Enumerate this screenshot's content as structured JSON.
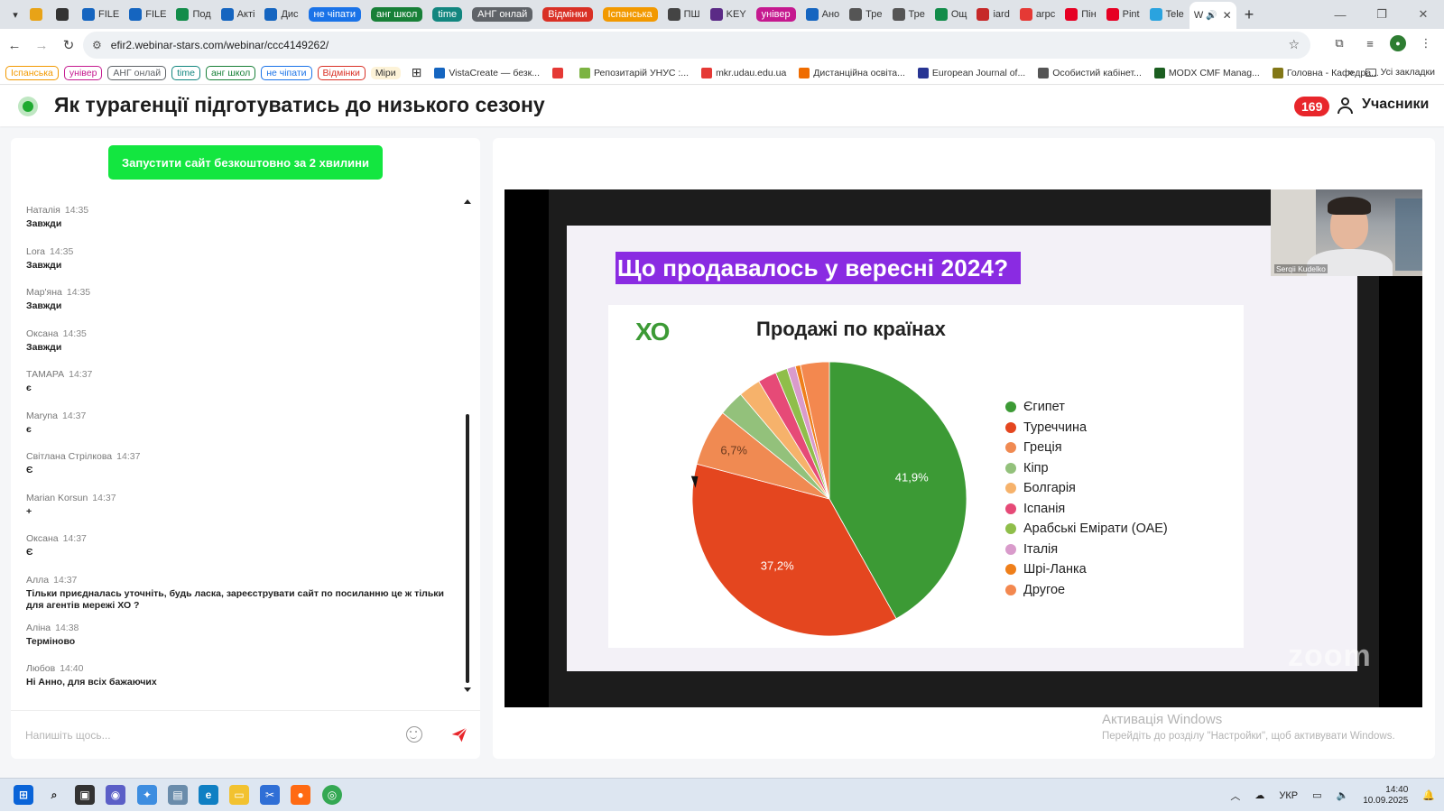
{
  "browser": {
    "tabs": [
      {
        "label": "",
        "fav": "#e8a317",
        "kind": "icon"
      },
      {
        "label": "",
        "fav": "#333333",
        "kind": "icon"
      },
      {
        "label": "FILE",
        "fav": "#1565c0",
        "kind": "tab"
      },
      {
        "label": "FILE",
        "fav": "#1565c0",
        "kind": "tab"
      },
      {
        "label": "Под",
        "fav": "#128c4a",
        "kind": "tab"
      },
      {
        "label": "Акті",
        "fav": "#1565c0",
        "kind": "tab"
      },
      {
        "label": "Дис",
        "fav": "#1565c0",
        "kind": "tab"
      },
      {
        "label": "не чіпати",
        "color": "#1a73e8",
        "kind": "pill"
      },
      {
        "label": "анг школ",
        "color": "#188038",
        "kind": "pill"
      },
      {
        "label": "time",
        "color": "#12867f",
        "kind": "pill"
      },
      {
        "label": "АНГ онлай",
        "color": "#5f6368",
        "kind": "pill"
      },
      {
        "label": "Відмінки",
        "color": "#d93025",
        "kind": "pill"
      },
      {
        "label": "Іспанська",
        "color": "#f29900",
        "kind": "pill"
      },
      {
        "label": "ПШ",
        "fav": "#444444",
        "kind": "tab"
      },
      {
        "label": "KEY",
        "fav": "#5b2a86",
        "kind": "tab"
      },
      {
        "label": "універ",
        "color": "#c5198f",
        "kind": "pill"
      },
      {
        "label": "Ано",
        "fav": "#1565c0",
        "kind": "tab"
      },
      {
        "label": "Тре",
        "fav": "#555555",
        "kind": "tab"
      },
      {
        "label": "Тре",
        "fav": "#555555",
        "kind": "tab"
      },
      {
        "label": "Ощ",
        "fav": "#128c4a",
        "kind": "tab"
      },
      {
        "label": "iard",
        "fav": "#c62828",
        "kind": "tab"
      },
      {
        "label": "arpc",
        "fav": "#e53935",
        "kind": "tab"
      },
      {
        "label": "Пін",
        "fav": "#e60023",
        "kind": "tab"
      },
      {
        "label": "Pint",
        "fav": "#e60023",
        "kind": "tab"
      },
      {
        "label": "Tele",
        "fav": "#2aa3df",
        "kind": "tab"
      }
    ],
    "active_tab": {
      "label": "W",
      "close": "✕"
    },
    "new_tab": "+",
    "url": "efir2.webinar-stars.com/webinar/ccc4149262/",
    "bookmarks": [
      {
        "label": "Іспанська",
        "color": "#f29900",
        "kind": "pill"
      },
      {
        "label": "універ",
        "color": "#c5198f",
        "kind": "pill"
      },
      {
        "label": "АНГ онлай",
        "color": "#5f6368",
        "kind": "pill"
      },
      {
        "label": "time",
        "color": "#12867f",
        "kind": "pill"
      },
      {
        "label": "анг школ",
        "color": "#188038",
        "kind": "pill"
      },
      {
        "label": "не чіпати",
        "color": "#1a73e8",
        "kind": "pill"
      },
      {
        "label": "Відмінки",
        "color": "#d93025",
        "kind": "pill"
      },
      {
        "label": "Міри",
        "color": "#f9ab00",
        "kind": "plain"
      },
      {
        "label": "",
        "color": "#555555",
        "kind": "grid"
      },
      {
        "label": "VistaCreate — безк...",
        "fav": "#1565c0",
        "kind": "fav"
      },
      {
        "label": "",
        "fav": "#e53935",
        "kind": "fav"
      },
      {
        "label": "Репозитарій УНУС :...",
        "fav": "#7cb342",
        "kind": "fav"
      },
      {
        "label": "mkr.udau.edu.ua",
        "fav": "#e53935",
        "kind": "fav"
      },
      {
        "label": "Дистанційна освіта...",
        "fav": "#ef6c00",
        "kind": "fav"
      },
      {
        "label": "European Journal of...",
        "fav": "#283593",
        "kind": "fav"
      },
      {
        "label": "Особистий кабінет...",
        "fav": "#555555",
        "kind": "fav"
      },
      {
        "label": "MODX CMF Manag...",
        "fav": "#1b5e20",
        "kind": "fav"
      },
      {
        "label": "Головна - Кафедра...",
        "fav": "#827717",
        "kind": "fav"
      }
    ],
    "bookmarks_more": "»",
    "all_bookmarks": "Усі закладки"
  },
  "header": {
    "title": "Як турагенції підготуватись до низького сезону",
    "participants_count": "169",
    "participants_label": "Учасники"
  },
  "chat": {
    "promo_button": "Запустити сайт безкоштовно за 2 хвилини",
    "messages": [
      {
        "author": "Наталія",
        "time": "14:35",
        "text": "Завжди"
      },
      {
        "author": "Lora",
        "time": "14:35",
        "text": "Завжди"
      },
      {
        "author": "Мар'яна",
        "time": "14:35",
        "text": "Завжди"
      },
      {
        "author": "Оксана",
        "time": "14:35",
        "text": "Завжди"
      },
      {
        "author": "ТАМАРА",
        "time": "14:37",
        "text": "є"
      },
      {
        "author": "Maryna",
        "time": "14:37",
        "text": "є"
      },
      {
        "author": "Світлана Стрілкова",
        "time": "14:37",
        "text": "Є"
      },
      {
        "author": "Marian Korsun",
        "time": "14:37",
        "text": "+"
      },
      {
        "author": "Оксана",
        "time": "14:37",
        "text": "Є"
      },
      {
        "author": "Алла",
        "time": "14:37",
        "text": "Тільки приєдналась уточніть, будь ласка, зареєструвати сайт по посиланню це ж тільки для агентів мережі ХО ?"
      },
      {
        "author": "Аліна",
        "time": "14:38",
        "text": "Терміново"
      },
      {
        "author": "Любов",
        "time": "14:40",
        "text": "Ні Анно, для всіх бажаючих"
      }
    ],
    "input_placeholder": "Напишіть щось..."
  },
  "slide": {
    "heading": "Що продавалось у вересні 2024?",
    "logo_text": "XO",
    "speaker_name": "Serqii Kudelko",
    "watermark": "zoom"
  },
  "chart_data": {
    "type": "pie",
    "title": "Продажі по країнах",
    "categories": [
      "Єгипет",
      "Туреччина",
      "Греція",
      "Кіпр",
      "Болгарія",
      "Іспанія",
      "Арабські Емірати (ОАЕ)",
      "Італія",
      "Шрі-Ланка",
      "Другое"
    ],
    "values": [
      41.9,
      37.2,
      6.7,
      3.0,
      2.6,
      2.2,
      1.4,
      1.0,
      0.6,
      3.4
    ],
    "data_labels": [
      "41,9%",
      "37,2%",
      "6,7%",
      "",
      "",
      "",
      "",
      "",
      "",
      ""
    ],
    "colors": [
      "#3c9a35",
      "#e4461f",
      "#f08a52",
      "#93c17b",
      "#f6b26b",
      "#e64a77",
      "#8fbe4a",
      "#d99bcb",
      "#ef7f1a",
      "#f3884f"
    ],
    "legend_position": "right"
  },
  "system": {
    "activation_title": "Активація Windows",
    "activation_text": "Перейдіть до розділу \"Настройки\", щоб активувати Windows.",
    "language": "УКР",
    "time": "14:40",
    "date": "10.09.2025"
  }
}
